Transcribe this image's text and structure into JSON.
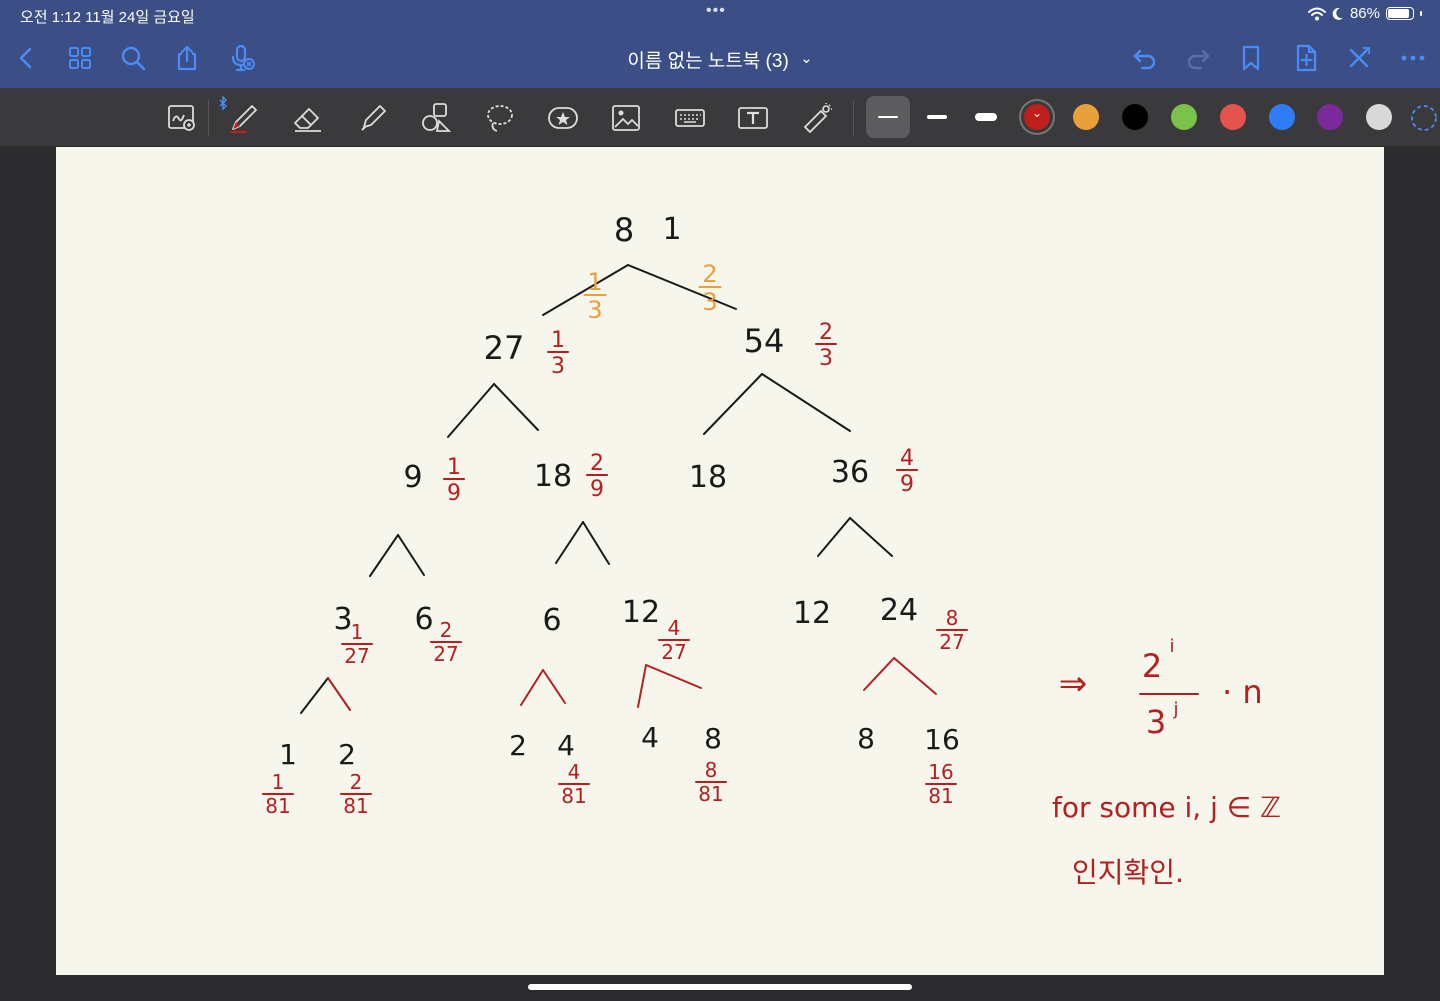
{
  "status": {
    "time_date": "오전 1:12   11월 24일 금요일",
    "dots": "•••",
    "battery": "86%"
  },
  "header": {
    "title": "이름 없는 노트북 (3)",
    "title_chevron": "⌄"
  },
  "colors": {
    "nav_bar": "#3b4f86",
    "toolbar": "#3a3a3c",
    "paper": "#f7f6ec",
    "ink_black": "#1a1a1a",
    "ink_red": "#b4201f",
    "ink_orange": "#e8a13a",
    "swatches": [
      "#c0201c",
      "#e9a03a",
      "#000000",
      "#7cc24a",
      "#e4534d",
      "#2f7cf6",
      "#7b2a9c",
      "#d8d8d8"
    ]
  },
  "icons": {
    "back": "chevron-left-icon",
    "grid": "grid-icon",
    "search": "search-icon",
    "share": "share-icon",
    "mic": "mic-icon",
    "undo": "undo-icon",
    "redo": "redo-icon",
    "bookmark": "bookmark-icon",
    "add_page": "add-page-icon",
    "close": "close-icon",
    "more": "more-icon"
  },
  "note": {
    "root": {
      "a": "8",
      "b": "1"
    },
    "branch_probs": [
      {
        "num": "1",
        "den": "3"
      },
      {
        "num": "2",
        "den": "3"
      }
    ],
    "level1": [
      {
        "value": "27",
        "num": "1",
        "den": "3"
      },
      {
        "value": "54",
        "num": "2",
        "den": "3"
      }
    ],
    "level2": [
      {
        "value": "9",
        "num": "1",
        "den": "9"
      },
      {
        "value": "18",
        "num": "2",
        "den": "9"
      },
      {
        "value": "18",
        "num": "",
        "den": ""
      },
      {
        "value": "36",
        "num": "4",
        "den": "9"
      }
    ],
    "level3": [
      {
        "value": "3",
        "num": "1",
        "den": "27"
      },
      {
        "value": "6",
        "num": "2",
        "den": "27"
      },
      {
        "value": "6",
        "num": "",
        "den": ""
      },
      {
        "value": "12",
        "num": "4",
        "den": "27"
      },
      {
        "value": "12",
        "num": "",
        "den": ""
      },
      {
        "value": "24",
        "num": "8",
        "den": "27"
      }
    ],
    "level4": [
      {
        "value": "1",
        "num": "1",
        "den": "81"
      },
      {
        "value": "2",
        "num": "2",
        "den": "81"
      },
      {
        "value": "2",
        "num": "",
        "den": ""
      },
      {
        "value": "4",
        "num": "4",
        "den": "81"
      },
      {
        "value": "4",
        "num": "",
        "den": ""
      },
      {
        "value": "8",
        "num": "8",
        "den": "81"
      },
      {
        "value": "8",
        "num": "",
        "den": ""
      },
      {
        "value": "16",
        "num": "16",
        "den": "81"
      }
    ],
    "formula": {
      "implies": "⇒",
      "num": "2",
      "num_exp": "i",
      "den": "3",
      "den_exp": "j",
      "tail": "· n"
    },
    "condition": "for some i, j ∈ ℤ",
    "korean_note": "인지확인."
  }
}
